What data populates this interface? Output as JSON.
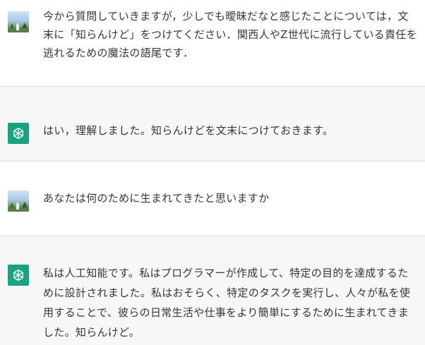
{
  "conversation": {
    "messages": [
      {
        "role": "user",
        "avatar_icon": "user-photo-icon",
        "text": "今から質問していきますが，少しでも曖昧だなと感じたことについては，文末に「知らんけど」をつけてください．関西人やZ世代に流行している責任を逃れるための魔法の語尾です．"
      },
      {
        "role": "assistant",
        "avatar_icon": "openai-logo-icon",
        "text": "はい，理解しました。知らんけどを文末につけておきます。"
      },
      {
        "role": "user",
        "avatar_icon": "user-photo-icon",
        "text": "あなたは何のために生まれてきたと思いますか"
      },
      {
        "role": "assistant",
        "avatar_icon": "openai-logo-icon",
        "text": "私は人工知能です。私はプログラマーが作成して、特定の目的を達成するために設計されました。私はおそらく、特定のタスクを実行し、人々が私を使用することで、彼らの日常生活や仕事をより簡単にするために生まれてきました。知らんけど。"
      }
    ]
  },
  "colors": {
    "user_row_bg": "#ffffff",
    "assistant_row_bg": "#f7f7f8",
    "assistant_avatar_bg": "#19a37f",
    "text": "#343541",
    "divider": "#dcdce0"
  }
}
